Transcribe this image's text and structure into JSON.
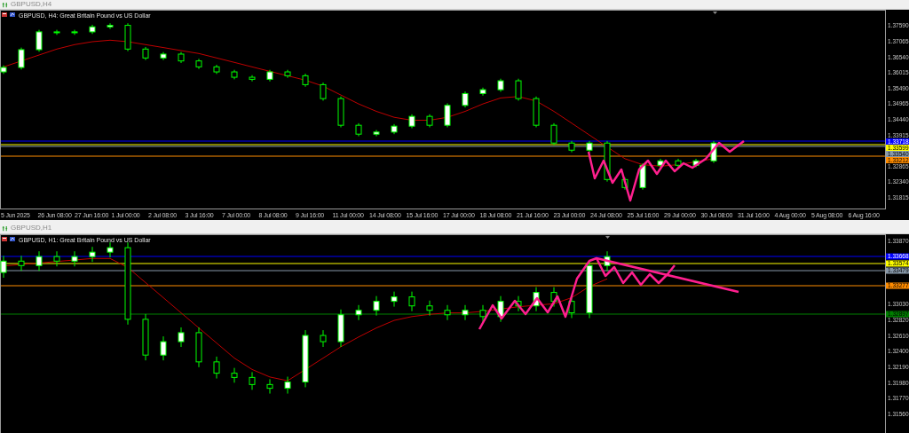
{
  "charts": [
    {
      "window_title": "GBPUSD,H4",
      "symbol_label": "GBPUSD, H4:  Great Britain Pound vs US Dollar",
      "price_axis": [
        "1.37590",
        "1.37065",
        "1.36540",
        "1.36015",
        "1.35490",
        "1.34965",
        "1.34440",
        "1.33915",
        "1.32865",
        "1.32340",
        "1.31815"
      ],
      "levels": [
        {
          "label": "1.33718",
          "color": "#0000ff"
        },
        {
          "label": "1.33599",
          "color": "#ffff00"
        },
        {
          "label": "1.33540",
          "color": "#8899aa"
        },
        {
          "label": "1.33212",
          "color": "#ff8c00"
        }
      ],
      "time_axis": [
        "5 Jun 2025",
        "26 Jun 08:00",
        "27 Jun 16:00",
        "1 Jul 00:00",
        "2 Jul 08:00",
        "3 Jul 16:00",
        "7 Jul 00:00",
        "8 Jul 08:00",
        "9 Jul 16:00",
        "11 Jul 00:00",
        "14 Jul 08:00",
        "15 Jul 16:00",
        "17 Jul 00:00",
        "18 Jul 08:00",
        "21 Jul 16:00",
        "23 Jul 00:00",
        "24 Jul 08:00",
        "25 Jul 16:00",
        "29 Jul 00:00",
        "30 Jul 08:00",
        "31 Jul 16:00",
        "4 Aug 00:00",
        "5 Aug 08:00",
        "6 Aug 16:00"
      ]
    },
    {
      "window_title": "GBPUSD,H1",
      "symbol_label": "GBPUSD, H1:  Great Britain Pound vs US Dollar",
      "price_axis": [
        "1.33870",
        "1.33030",
        "1.32820",
        "1.32610",
        "1.32400",
        "1.32190",
        "1.31980",
        "1.31770",
        "1.31560"
      ],
      "levels": [
        {
          "label": "1.33668",
          "color": "#0000ff"
        },
        {
          "label": "1.33574",
          "color": "#ffff00"
        },
        {
          "label": "1.33479",
          "color": "#8899aa"
        },
        {
          "label": "1.33277",
          "color": "#ff8c00"
        },
        {
          "label": "1.32897",
          "color": "#008000"
        }
      ]
    }
  ]
}
